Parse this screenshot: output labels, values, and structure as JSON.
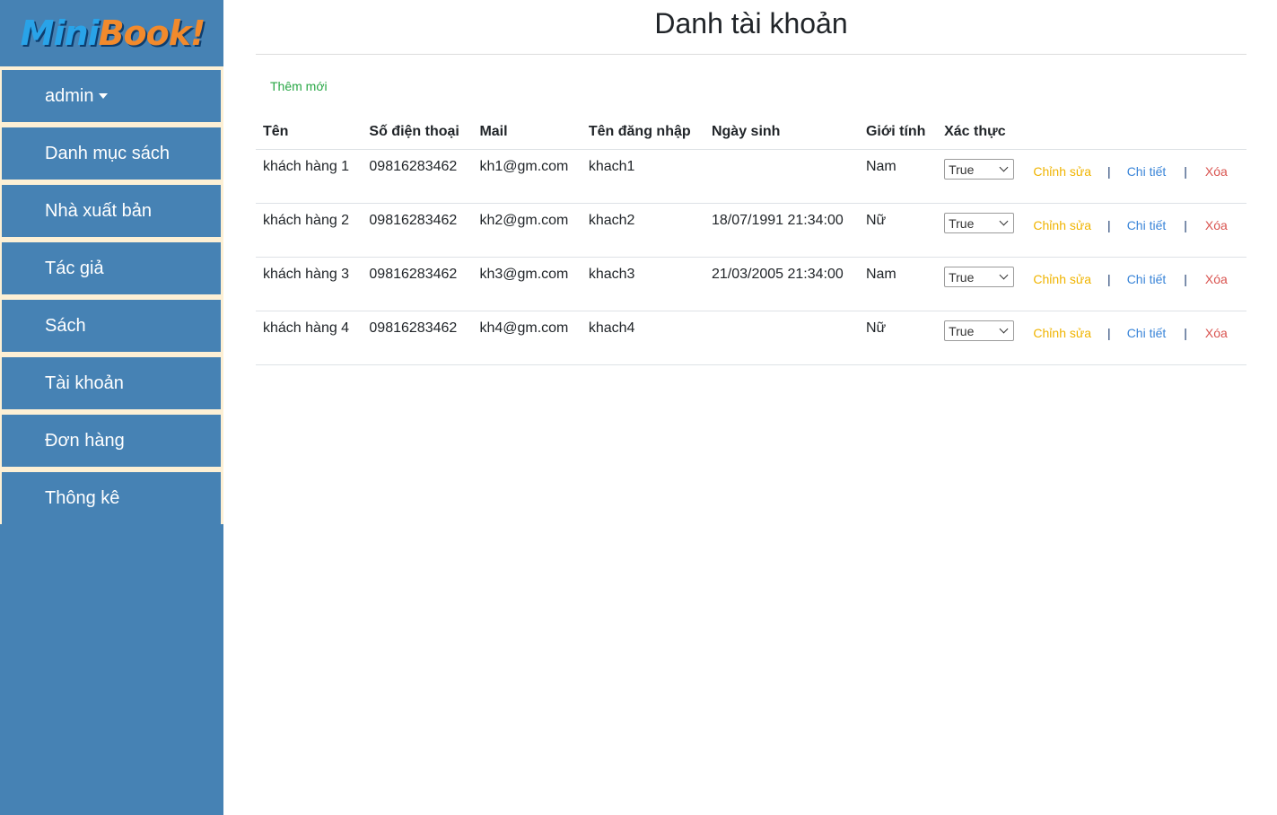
{
  "brand": {
    "logo_part1": "Mini",
    "logo_part2": "Book!"
  },
  "sidebar": {
    "items": [
      {
        "label": "admin"
      },
      {
        "label": "Danh mục sách"
      },
      {
        "label": "Nhà xuất bản"
      },
      {
        "label": "Tác giả"
      },
      {
        "label": "Sách"
      },
      {
        "label": "Tài khoản"
      },
      {
        "label": "Đơn hàng"
      },
      {
        "label": "Thông kê"
      }
    ]
  },
  "main": {
    "title": "Danh tài khoản",
    "add_link": "Thêm mới",
    "table": {
      "headers": [
        "Tên",
        "Số điện thoại",
        "Mail",
        "Tên đăng nhập",
        "Ngày sinh",
        "Giới tính",
        "Xác thực"
      ],
      "rows": [
        {
          "name": "khách hàng 1",
          "phone": "09816283462",
          "mail": "kh1@gm.com",
          "username": "khach1",
          "birthday": "",
          "gender": "Nam",
          "verified": "True"
        },
        {
          "name": "khách hàng 2",
          "phone": "09816283462",
          "mail": "kh2@gm.com",
          "username": "khach2",
          "birthday": "18/07/1991 21:34:00",
          "gender": "Nữ",
          "verified": "True"
        },
        {
          "name": "khách hàng 3",
          "phone": "09816283462",
          "mail": "kh3@gm.com",
          "username": "khach3",
          "birthday": "21/03/2005 21:34:00",
          "gender": "Nam",
          "verified": "True"
        },
        {
          "name": "khách hàng 4",
          "phone": "09816283462",
          "mail": "kh4@gm.com",
          "username": "khach4",
          "birthday": "",
          "gender": "Nữ",
          "verified": "True"
        }
      ],
      "actions": {
        "edit": "Chỉnh sửa",
        "detail": "Chi tiết",
        "delete": "Xóa",
        "separator": "|"
      }
    }
  },
  "colors": {
    "sidebar": "#4682b4",
    "menu_gap": "#fdf0d5",
    "add_link": "#28a745",
    "edit": "#f0b400",
    "detail": "#3a85d8",
    "delete": "#d9534f"
  }
}
